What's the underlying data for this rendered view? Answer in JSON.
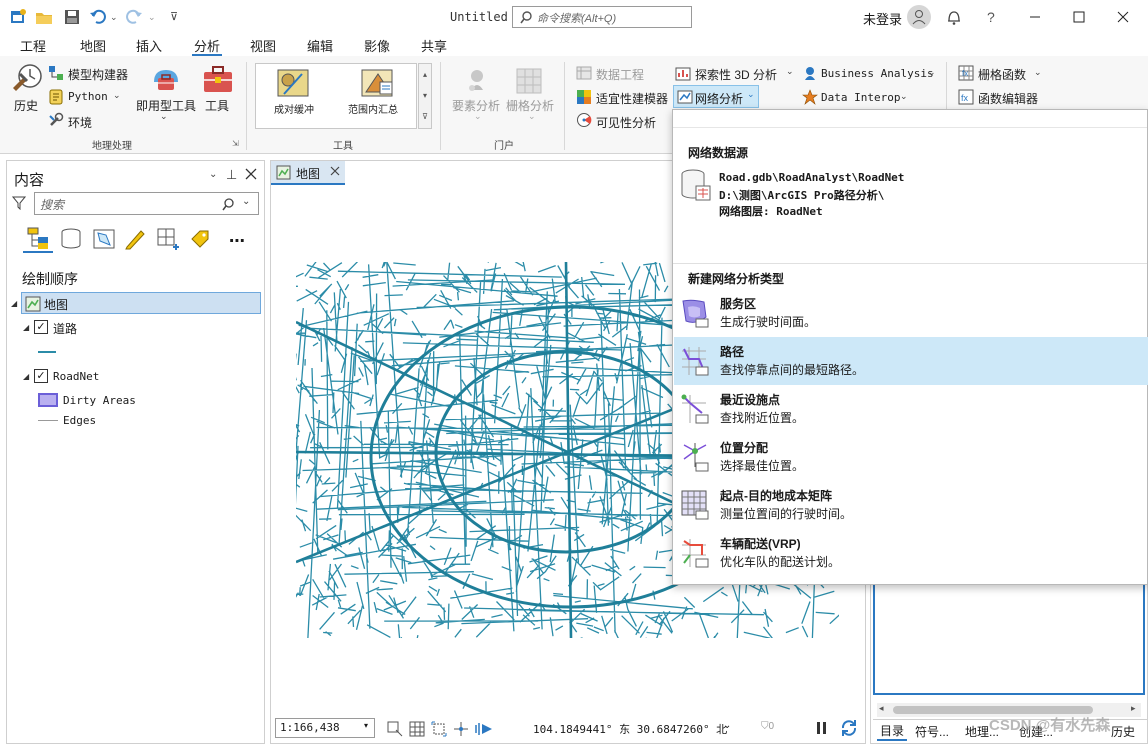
{
  "titlebar": {
    "title": "Untitled",
    "search_placeholder": "命令搜索(Alt+Q)",
    "user": "未登录",
    "help": "?"
  },
  "menu": {
    "tabs": [
      "工程",
      "地图",
      "插入",
      "分析",
      "视图",
      "编辑",
      "影像",
      "共享"
    ],
    "active": "分析"
  },
  "ribbon": {
    "geoprocessing": {
      "history": "历史",
      "model_builder": "模型构建器",
      "python": "Python",
      "environments": "环境",
      "ready_tools": "即用型工具",
      "tools": "工具",
      "group_label": "地理处理"
    },
    "tools_gallery": {
      "item1": "成对缓冲",
      "item2": "范围内汇总",
      "group_label": "工具"
    },
    "portal": {
      "feature_analysis": "要素分析",
      "raster_analysis": "栅格分析",
      "group_label": "门户"
    },
    "workflows": {
      "data_engineering": "数据工程",
      "suitability_modeler": "适宜性建模器",
      "visibility": "可见性分析",
      "exploratory_3d": "探索性 3D 分析",
      "network_analysis": "网络分析",
      "business_analysis": "Business Analysis",
      "data_interop": "Data Interop"
    },
    "raster": {
      "raster_functions": "栅格函数",
      "function_editor": "函数编辑器"
    }
  },
  "contents": {
    "title": "内容",
    "search_placeholder": "搜索",
    "drawing_order": "绘制顺序",
    "map_name": "地图",
    "layer1": "道路",
    "layer2": "RoadNet",
    "sub1": "Dirty Areas",
    "sub2": "Edges"
  },
  "mapview": {
    "tab": "地图",
    "scale": "1:166,438",
    "coords": "104.1849441° 东  30.6847260° 北",
    "selected_count": "0"
  },
  "dropdown": {
    "source_heading": "网络数据源",
    "source_path1": "Road.gdb\\RoadAnalyst\\RoadNet",
    "source_path2": "D:\\测图\\ArcGIS Pro路径分析\\",
    "source_layer": "网络图层: RoadNet",
    "new_heading": "新建网络分析类型",
    "items": [
      {
        "title": "服务区",
        "desc": "生成行驶时间面。"
      },
      {
        "title": "路径",
        "desc": "查找停靠点间的最短路径。"
      },
      {
        "title": "最近设施点",
        "desc": "查找附近位置。"
      },
      {
        "title": "位置分配",
        "desc": "选择最佳位置。"
      },
      {
        "title": "起点-目的地成本矩阵",
        "desc": "测量位置间的行驶时间。"
      },
      {
        "title": "车辆配送(VRP)",
        "desc": "优化车队的配送计划。"
      }
    ]
  },
  "rightpane": {
    "tabs": [
      "目录",
      "符号...",
      "地理...",
      "创建...",
      "历史"
    ],
    "watermark": "CSDN @有水先森"
  }
}
